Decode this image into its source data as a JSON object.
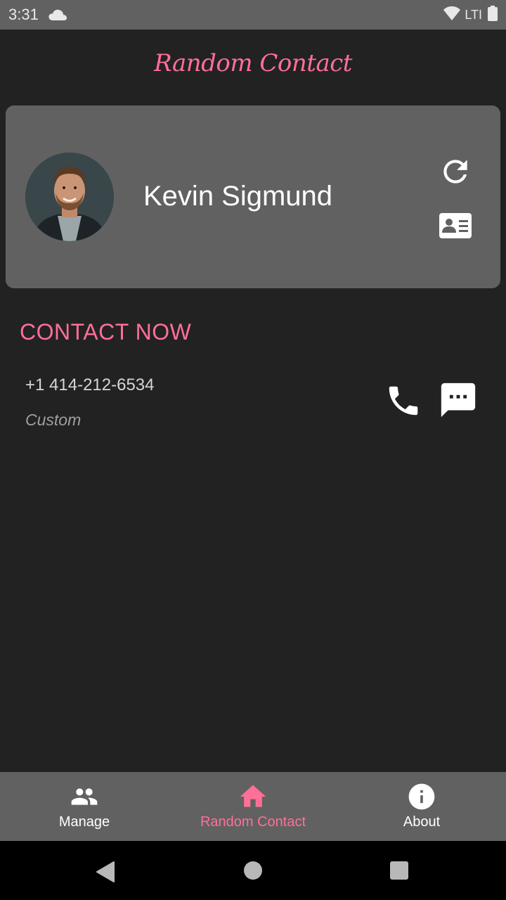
{
  "status_bar": {
    "time": "3:31",
    "network": "LTI",
    "icons": [
      "cloud-icon",
      "wifi-icon",
      "battery-icon"
    ]
  },
  "app": {
    "title": "Random Contact"
  },
  "contact": {
    "name": "Kevin Sigmund",
    "actions": [
      "refresh-icon",
      "contact-card-icon"
    ]
  },
  "contact_now": {
    "title": "CONTACT NOW",
    "phone_number": "+1 414-212-6534",
    "phone_type": "Custom",
    "actions": [
      "phone-icon",
      "message-icon"
    ]
  },
  "bottom_nav": {
    "items": [
      {
        "label": "Manage",
        "icon": "people-icon",
        "active": false
      },
      {
        "label": "Random Contact",
        "icon": "home-icon",
        "active": true
      },
      {
        "label": "About",
        "icon": "info-icon",
        "active": false
      }
    ]
  },
  "colors": {
    "accent": "#ff6f98",
    "background": "#222222",
    "surface": "#616161"
  }
}
